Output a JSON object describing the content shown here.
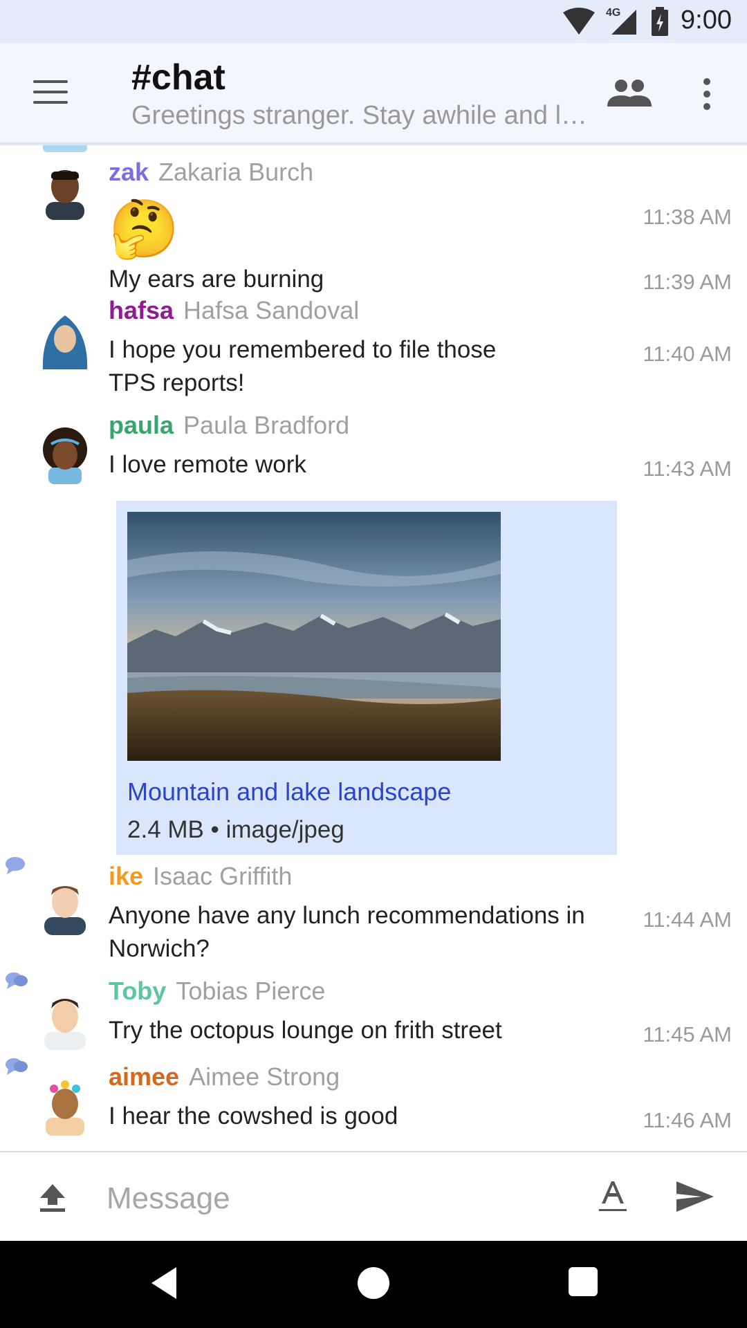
{
  "status_bar": {
    "time": "9:00",
    "network": "4G"
  },
  "header": {
    "title": "#chat",
    "topic": "Greetings stranger. Stay awhile and listen."
  },
  "messages": [
    {
      "nick": "zak",
      "name": "Zakaria Burch",
      "color": "#7c6ee0",
      "lines": [
        {
          "text": "🤔",
          "time": "11:38 AM"
        },
        {
          "text": "My ears are burning",
          "time": "11:39 AM"
        }
      ]
    },
    {
      "nick": "hafsa",
      "name": "Hafsa Sandoval",
      "color": "#8e1c93",
      "text": "I hope you remembered to file those TPS reports!",
      "time": "11:40 AM"
    },
    {
      "nick": "paula",
      "name": "Paula Bradford",
      "color": "#3aa46d",
      "text": "I love remote work",
      "time": "11:43 AM",
      "attachment": {
        "title": "Mountain and lake landscape",
        "meta": "2.4 MB • image/jpeg"
      }
    },
    {
      "nick": "ike",
      "name": "Isaac Griffith",
      "color": "#f39a1c",
      "text": "Anyone have any lunch recommendations in Norwich?",
      "time": "11:44 AM"
    },
    {
      "nick": "Toby",
      "name": "Tobias Pierce",
      "color": "#5bc6a0",
      "text": "Try the octopus lounge on frith street",
      "time": "11:45 AM"
    },
    {
      "nick": "aimee",
      "name": "Aimee Strong",
      "color": "#d4691c",
      "text": "I hear the cowshed is good",
      "time": "11:46 AM"
    }
  ],
  "composer": {
    "placeholder": "Message"
  }
}
